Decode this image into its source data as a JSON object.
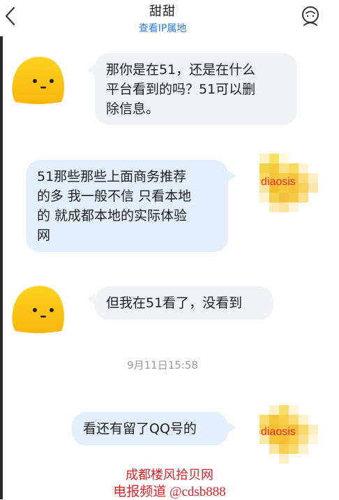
{
  "header": {
    "title": "甜甜",
    "ip_link": "查看IP属地"
  },
  "messages": [
    {
      "direction": "incoming",
      "lines": [
        "那你是在51，还是在什么",
        "平台看到的吗？51可以删",
        "除信息。"
      ]
    },
    {
      "direction": "outgoing",
      "lines": [
        "51那些那些上面商务推荐",
        "的多 我一般不信 只看本地",
        "的 就成都本地的实际体验",
        "网"
      ]
    },
    {
      "direction": "incoming",
      "lines": [
        "但我在51看了，没看到"
      ]
    },
    {
      "direction": "outgoing",
      "lines": [
        "看还有留了QQ号的"
      ]
    }
  ],
  "timestamp": "9月11日15:58",
  "self_avatar_label": "diaosis",
  "watermark": {
    "line1": "成都楼风拾贝网",
    "line2": "电报频道 @cdsb888"
  },
  "colors": {
    "link": "#2b7ad6",
    "incoming_bubble": "#f1f2f4",
    "outgoing_bubble": "#e3f0fb",
    "avatar_yellow": "#ffc21a",
    "watermark_red": "#e01f25"
  },
  "icons": {
    "back": "chevron-left-icon",
    "profile": "person-icon",
    "contact_avatar": "yellow-blob-face-icon"
  }
}
